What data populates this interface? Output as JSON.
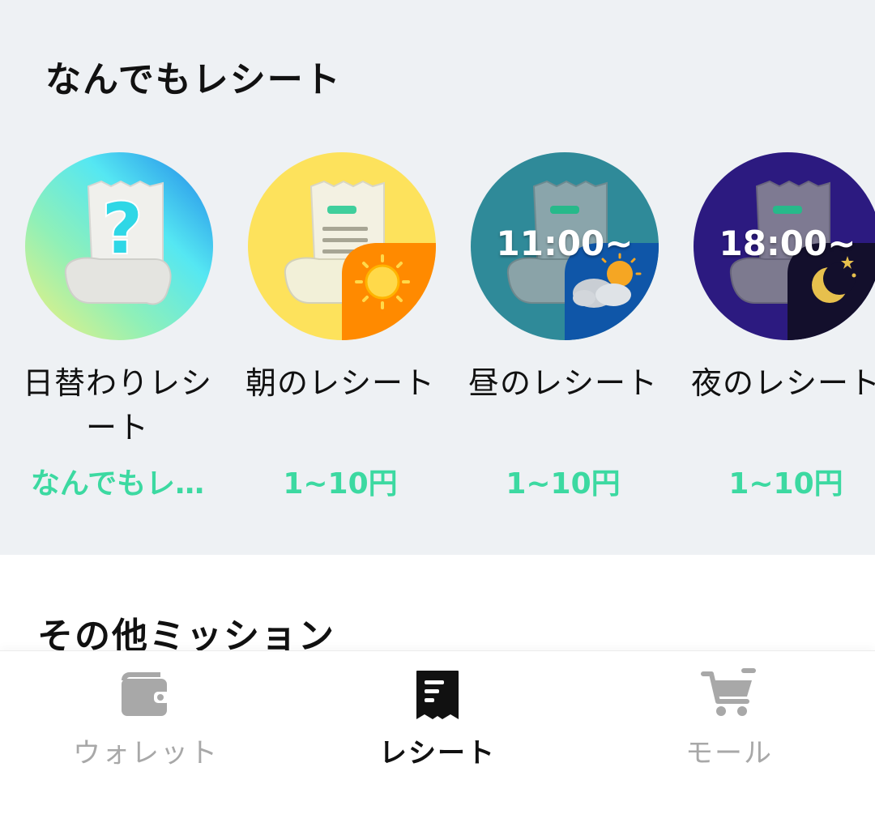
{
  "receipts_section": {
    "title": "なんでもレシート",
    "cards": [
      {
        "name": "日替わりレシート",
        "reward": "なんでもレ…",
        "icon": "question-receipt-icon"
      },
      {
        "name": "朝のレシート",
        "reward": "1~10円",
        "icon": "morning-receipt-icon"
      },
      {
        "name": "昼のレシート",
        "reward": "1~10円",
        "time": "11:00~",
        "icon": "noon-receipt-icon"
      },
      {
        "name": "夜のレシート",
        "reward": "1~10円",
        "time": "18:00~",
        "icon": "night-receipt-icon"
      }
    ]
  },
  "other_section": {
    "title": "その他ミッション"
  },
  "tabbar": {
    "tabs": [
      {
        "label": "ウォレット",
        "icon": "wallet-icon",
        "active": false
      },
      {
        "label": "レシート",
        "icon": "receipt-icon",
        "active": true
      },
      {
        "label": "モール",
        "icon": "cart-icon",
        "active": false
      }
    ]
  },
  "colors": {
    "reward": "#3cd9a1",
    "section_bg": "#eef1f4",
    "inactive_tab": "#a8a8a8"
  }
}
